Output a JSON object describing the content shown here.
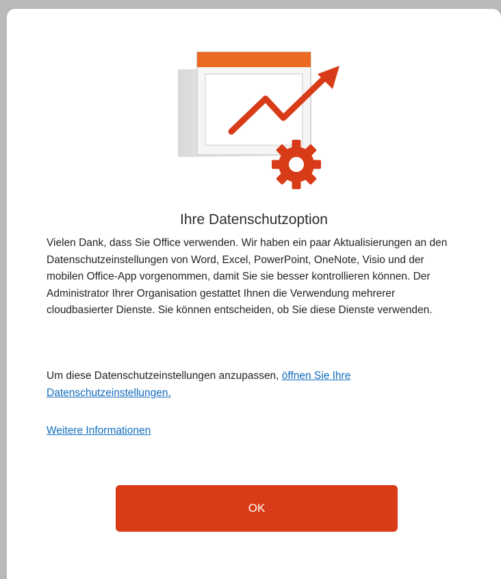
{
  "dialog": {
    "title": "Ihre Datenschutzoption",
    "body": "Vielen Dank, dass Sie Office verwenden. Wir haben ein paar Aktualisierungen an den Datenschutzeinstellungen von Word, Excel, PowerPoint, OneNote, Visio und der mobilen Office-App vorgenommen, damit Sie sie besser kontrollieren können. Der Administrator Ihrer Organisation gestattet Ihnen die Verwendung mehrerer cloudbasierter Dienste. Sie können entscheiden, ob Sie diese Dienste verwenden.",
    "privacy_prefix": "Um diese Datenschutzeinstellungen anzupassen, ",
    "privacy_link": "öffnen Sie Ihre Datenschutzeinstellungen.",
    "more_info_link": "Weitere Informationen",
    "ok_label": "OK"
  },
  "illustration": {
    "icons": [
      "window-icon",
      "trend-arrow-icon",
      "gear-icon"
    ],
    "accent_color": "#d83b17",
    "header_color": "#ea6a23"
  },
  "colors": {
    "button": "#d83b17",
    "link": "#0f6cbd",
    "backdrop": "#b9b9b9"
  }
}
